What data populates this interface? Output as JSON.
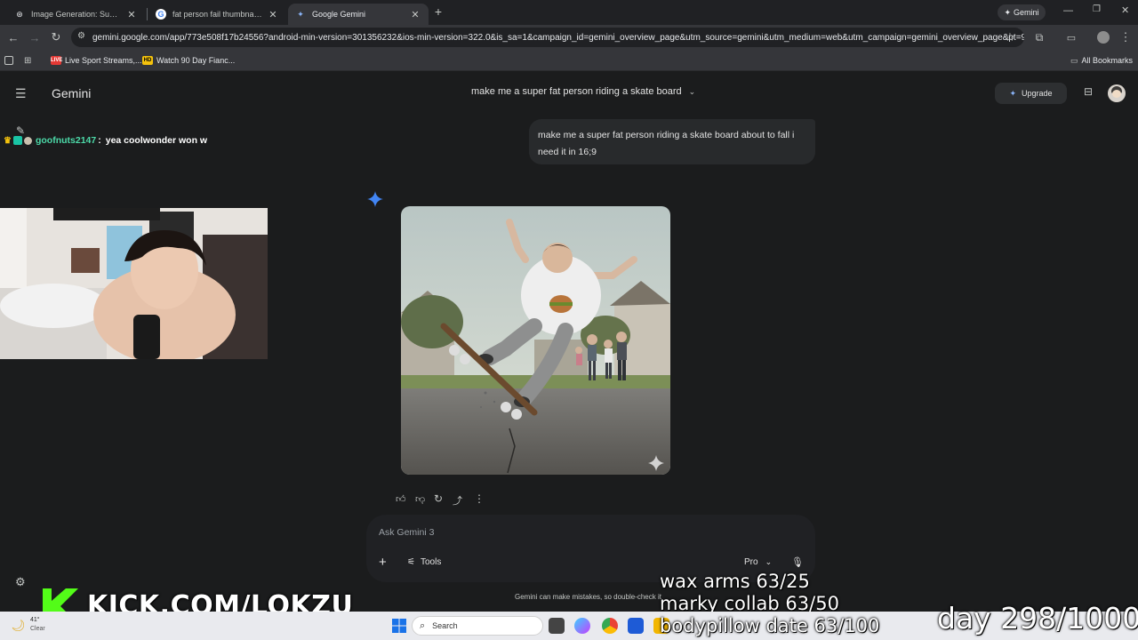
{
  "tabs": [
    {
      "title": "Image Generation: Super Fat P",
      "active": false
    },
    {
      "title": "fat person fail thumbnail - Goo",
      "active": false
    },
    {
      "title": "Google Gemini",
      "active": true
    }
  ],
  "browser": {
    "url": "gemini.google.com/app/773e508f17b24556?android-min-version=301356232&ios-min-version=322.0&is_sa=1&campaign_id=gemini_overview_page&utm_source=gemini&utm_medium=web&utm_campaign=gemini_overview_page&pt=9008...",
    "profile_chip": "Gemini",
    "bookmarks": [
      "Live Sport Streams,...",
      "Watch 90 Day Fianc..."
    ],
    "all_bookmarks": "All Bookmarks"
  },
  "gemini": {
    "brand": "Gemini",
    "conversation_title": "make me a super fat person riding a skate board",
    "upgrade_label": "Upgrade",
    "user_message": "make me a super fat person riding a skate board about to fall i need it in 16;9",
    "input_placeholder": "Ask Gemini 3",
    "tools_label": "Tools",
    "model_label": "Pro",
    "disclaimer": "Gemini can make mistakes, so double-check it"
  },
  "stream": {
    "chat_user": "goofnuts2147",
    "chat_message": "yea coolwonder won w",
    "kick_url": "KICK.COM/LOKZU",
    "goal_1": "wax arms 63/25",
    "goal_2": "marky collab 63/50",
    "goal_3": "bodypillow date 63/100",
    "day_counter": "day 298/1000"
  },
  "taskbar": {
    "search_label": "Search",
    "weather_temp": "41°",
    "weather_desc": "Clear"
  },
  "colors": {
    "gemini_bg": "#1b1c1d",
    "bubble_bg": "#282a2c",
    "sparkle_blue": "#4285f4",
    "chat_name": "#4cd9a8"
  }
}
